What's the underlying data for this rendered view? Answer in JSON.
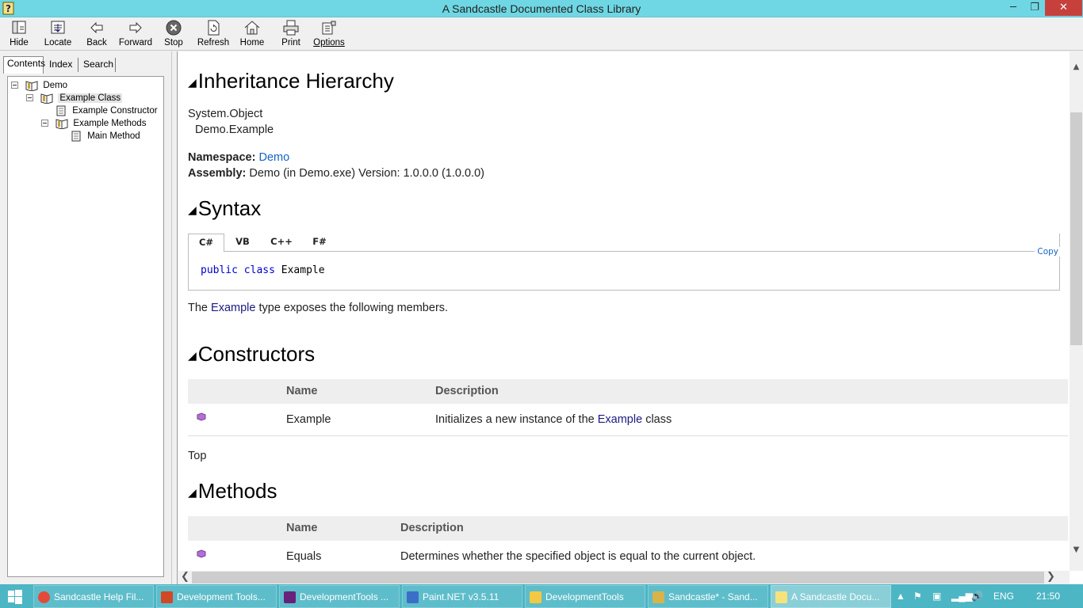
{
  "window": {
    "title": "A Sandcastle Documented Class Library"
  },
  "toolbar": {
    "hide": "Hide",
    "locate": "Locate",
    "back": "Back",
    "forward": "Forward",
    "stop": "Stop",
    "refresh": "Refresh",
    "home": "Home",
    "print": "Print",
    "options": "Options"
  },
  "nav_tabs": {
    "contents": "Contents",
    "index": "Index",
    "search": "Search"
  },
  "tree": {
    "demo": "Demo",
    "example_class": "Example Class",
    "example_constructor": "Example Constructor",
    "example_methods": "Example Methods",
    "main_method": "Main Method"
  },
  "content": {
    "inheritance_heading": "Inheritance Hierarchy",
    "base_type": "System.Object",
    "derived_type": "Demo.Example",
    "namespace_label": "Namespace:",
    "namespace_value": "Demo",
    "assembly_label": "Assembly:",
    "assembly_value": "Demo (in Demo.exe) Version: 1.0.0.0 (1.0.0.0)",
    "syntax_heading": "Syntax",
    "lang_tabs": [
      "C#",
      "VB",
      "C++",
      "F#"
    ],
    "copy": "Copy",
    "code_kw1": "public",
    "code_kw2": "class",
    "code_name": "Example",
    "exposes_pre": "The",
    "exposes_link": "Example",
    "exposes_post": "type exposes the following members.",
    "constructors_heading": "Constructors",
    "col_name": "Name",
    "col_description": "Description",
    "ctor_name": "Example",
    "ctor_desc_pre": "Initializes a new instance of the",
    "ctor_desc_link": "Example",
    "ctor_desc_post": "class",
    "top_link": "Top",
    "methods_heading": "Methods",
    "method_name": "Equals",
    "method_desc": "Determines whether the specified object is equal to the current object."
  },
  "taskbar": {
    "items": [
      "Sandcastle Help Fil...",
      "Development Tools...",
      "DevelopmentTools ...",
      "Paint.NET v3.5.11",
      "DevelopmentTools",
      "Sandcastle* - Sand...",
      "A Sandcastle Docu..."
    ],
    "language": "ENG",
    "time": "21:50"
  }
}
